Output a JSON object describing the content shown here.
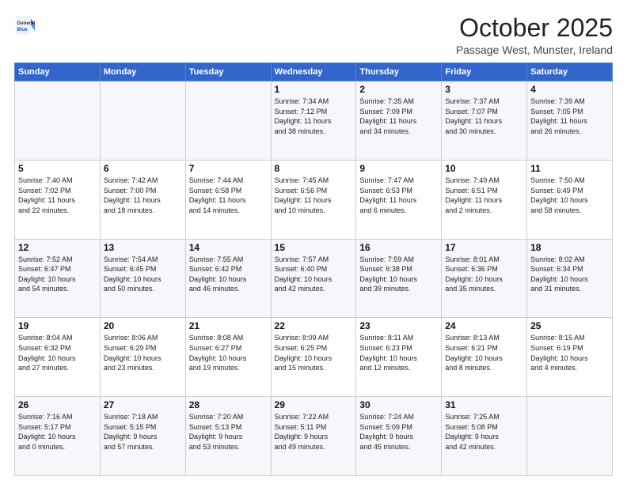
{
  "header": {
    "logo_general": "General",
    "logo_blue": "Blue",
    "month_title": "October 2025",
    "location": "Passage West, Munster, Ireland"
  },
  "days_of_week": [
    "Sunday",
    "Monday",
    "Tuesday",
    "Wednesday",
    "Thursday",
    "Friday",
    "Saturday"
  ],
  "weeks": [
    [
      {
        "day": "",
        "info": ""
      },
      {
        "day": "",
        "info": ""
      },
      {
        "day": "",
        "info": ""
      },
      {
        "day": "1",
        "info": "Sunrise: 7:34 AM\nSunset: 7:12 PM\nDaylight: 11 hours\nand 38 minutes."
      },
      {
        "day": "2",
        "info": "Sunrise: 7:35 AM\nSunset: 7:09 PM\nDaylight: 11 hours\nand 34 minutes."
      },
      {
        "day": "3",
        "info": "Sunrise: 7:37 AM\nSunset: 7:07 PM\nDaylight: 11 hours\nand 30 minutes."
      },
      {
        "day": "4",
        "info": "Sunrise: 7:39 AM\nSunset: 7:05 PM\nDaylight: 11 hours\nand 26 minutes."
      }
    ],
    [
      {
        "day": "5",
        "info": "Sunrise: 7:40 AM\nSunset: 7:02 PM\nDaylight: 11 hours\nand 22 minutes."
      },
      {
        "day": "6",
        "info": "Sunrise: 7:42 AM\nSunset: 7:00 PM\nDaylight: 11 hours\nand 18 minutes."
      },
      {
        "day": "7",
        "info": "Sunrise: 7:44 AM\nSunset: 6:58 PM\nDaylight: 11 hours\nand 14 minutes."
      },
      {
        "day": "8",
        "info": "Sunrise: 7:45 AM\nSunset: 6:56 PM\nDaylight: 11 hours\nand 10 minutes."
      },
      {
        "day": "9",
        "info": "Sunrise: 7:47 AM\nSunset: 6:53 PM\nDaylight: 11 hours\nand 6 minutes."
      },
      {
        "day": "10",
        "info": "Sunrise: 7:49 AM\nSunset: 6:51 PM\nDaylight: 11 hours\nand 2 minutes."
      },
      {
        "day": "11",
        "info": "Sunrise: 7:50 AM\nSunset: 6:49 PM\nDaylight: 10 hours\nand 58 minutes."
      }
    ],
    [
      {
        "day": "12",
        "info": "Sunrise: 7:52 AM\nSunset: 6:47 PM\nDaylight: 10 hours\nand 54 minutes."
      },
      {
        "day": "13",
        "info": "Sunrise: 7:54 AM\nSunset: 6:45 PM\nDaylight: 10 hours\nand 50 minutes."
      },
      {
        "day": "14",
        "info": "Sunrise: 7:55 AM\nSunset: 6:42 PM\nDaylight: 10 hours\nand 46 minutes."
      },
      {
        "day": "15",
        "info": "Sunrise: 7:57 AM\nSunset: 6:40 PM\nDaylight: 10 hours\nand 42 minutes."
      },
      {
        "day": "16",
        "info": "Sunrise: 7:59 AM\nSunset: 6:38 PM\nDaylight: 10 hours\nand 39 minutes."
      },
      {
        "day": "17",
        "info": "Sunrise: 8:01 AM\nSunset: 6:36 PM\nDaylight: 10 hours\nand 35 minutes."
      },
      {
        "day": "18",
        "info": "Sunrise: 8:02 AM\nSunset: 6:34 PM\nDaylight: 10 hours\nand 31 minutes."
      }
    ],
    [
      {
        "day": "19",
        "info": "Sunrise: 8:04 AM\nSunset: 6:32 PM\nDaylight: 10 hours\nand 27 minutes."
      },
      {
        "day": "20",
        "info": "Sunrise: 8:06 AM\nSunset: 6:29 PM\nDaylight: 10 hours\nand 23 minutes."
      },
      {
        "day": "21",
        "info": "Sunrise: 8:08 AM\nSunset: 6:27 PM\nDaylight: 10 hours\nand 19 minutes."
      },
      {
        "day": "22",
        "info": "Sunrise: 8:09 AM\nSunset: 6:25 PM\nDaylight: 10 hours\nand 15 minutes."
      },
      {
        "day": "23",
        "info": "Sunrise: 8:11 AM\nSunset: 6:23 PM\nDaylight: 10 hours\nand 12 minutes."
      },
      {
        "day": "24",
        "info": "Sunrise: 8:13 AM\nSunset: 6:21 PM\nDaylight: 10 hours\nand 8 minutes."
      },
      {
        "day": "25",
        "info": "Sunrise: 8:15 AM\nSunset: 6:19 PM\nDaylight: 10 hours\nand 4 minutes."
      }
    ],
    [
      {
        "day": "26",
        "info": "Sunrise: 7:16 AM\nSunset: 5:17 PM\nDaylight: 10 hours\nand 0 minutes."
      },
      {
        "day": "27",
        "info": "Sunrise: 7:18 AM\nSunset: 5:15 PM\nDaylight: 9 hours\nand 57 minutes."
      },
      {
        "day": "28",
        "info": "Sunrise: 7:20 AM\nSunset: 5:13 PM\nDaylight: 9 hours\nand 53 minutes."
      },
      {
        "day": "29",
        "info": "Sunrise: 7:22 AM\nSunset: 5:11 PM\nDaylight: 9 hours\nand 49 minutes."
      },
      {
        "day": "30",
        "info": "Sunrise: 7:24 AM\nSunset: 5:09 PM\nDaylight: 9 hours\nand 45 minutes."
      },
      {
        "day": "31",
        "info": "Sunrise: 7:25 AM\nSunset: 5:08 PM\nDaylight: 9 hours\nand 42 minutes."
      },
      {
        "day": "",
        "info": ""
      }
    ]
  ]
}
